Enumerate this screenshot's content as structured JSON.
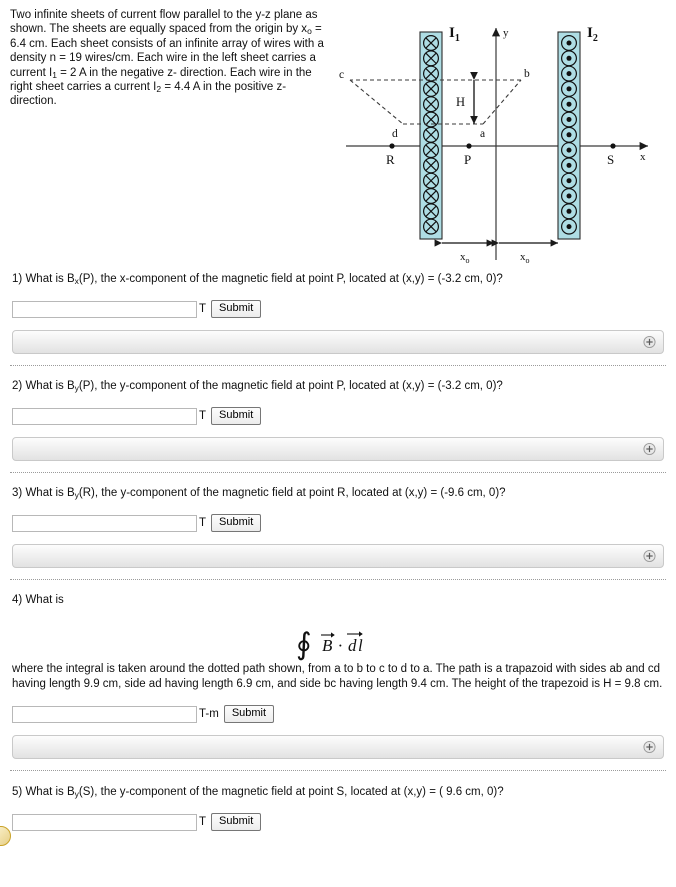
{
  "intro": {
    "line1": "Two infinite sheets of current flow parallel to the y-z",
    "line2": "plane as shown. The sheets are equally spaced from the",
    "line3_pre": "origin by x",
    "line3_sub": "o",
    "line3_post": " = 6.4 cm. Each sheet consists of an infinite",
    "line4": "array of wires with a density n = 19 wires/cm. Each wire in",
    "line5_pre": "the left sheet carries a current I",
    "line5_sub": "1",
    "line5_post": " = 2 A in the negative z-",
    "line6_pre": "direction. Each wire in the right sheet carries a current I",
    "line6_sub": "2",
    "line7": "= 4.4 A in the positive z-direction."
  },
  "figure": {
    "label_I1": "I",
    "label_I1_sub": "1",
    "label_I2": "I",
    "label_I2_sub": "2",
    "axis_y": "y",
    "axis_x": "x",
    "point_P": "P",
    "point_R": "R",
    "point_S": "S",
    "vertex_a": "a",
    "vertex_b": "b",
    "vertex_c": "c",
    "vertex_d": "d",
    "height_label": "H",
    "dim_left": "x",
    "dim_left_sub": "o",
    "dim_right": "x",
    "dim_right_sub": "o",
    "sheet_color": "#aedde4",
    "sheet_border": "#2b2b2b",
    "left_sheet_wire_count": 13,
    "right_sheet_wire_count": 13,
    "left_sheet_symbol": "cross",
    "right_sheet_symbol": "dot"
  },
  "questions": [
    {
      "number": "1)",
      "text_pre": "What is B",
      "text_sub": "x",
      "text_post": "(P), the x-component of the magnetic field at point P, located at (x,y) = (-3.2 cm, 0)?",
      "input_value": "",
      "input_placeholder": "",
      "unit": "T",
      "submit_label": "Submit"
    },
    {
      "number": "2)",
      "text_pre": "What is B",
      "text_sub": "y",
      "text_post": "(P), the y-component of the magnetic field at point P, located at (x,y) = (-3.2 cm, 0)?",
      "input_value": "",
      "input_placeholder": "",
      "unit": "T",
      "submit_label": "Submit"
    },
    {
      "number": "3)",
      "text_pre": "What is B",
      "text_sub": "y",
      "text_post": "(R), the y-component of the magnetic field at point R, located at (x,y) = (-9.6 cm, 0)?",
      "input_value": "",
      "input_placeholder": "",
      "unit": "T",
      "submit_label": "Submit"
    }
  ],
  "question4": {
    "number": "4)",
    "prompt": "What is",
    "formula_alt": "contour integral of B dot dl",
    "body_line1": "where the integral is taken around the dotted path shown, from a to b to c to d to a. The path is a trapazoid with sides",
    "body_line2": "ab and cd having length 9.9 cm, side ad having length 6.9 cm, and side bc having length 9.4 cm. The height of the",
    "body_line3": "trapezoid is H = 9.8 cm.",
    "input_value": "",
    "input_placeholder": "",
    "unit": "T-m",
    "submit_label": "Submit"
  },
  "question5": {
    "number": "5)",
    "text_pre": "What is B",
    "text_sub": "y",
    "text_post": "(S), the y-component of the magnetic field at point S, located at ( 9.6 cm, 0)?",
    "text_full_post": "(S), the y-component of the magnetic field at point S, located at (x,y) = ( 9.6 cm, 0)?",
    "input_value": "",
    "input_placeholder": "",
    "unit": "T",
    "submit_label": "Submit"
  },
  "icons": {
    "expand_hint": "plus-circle-icon"
  }
}
